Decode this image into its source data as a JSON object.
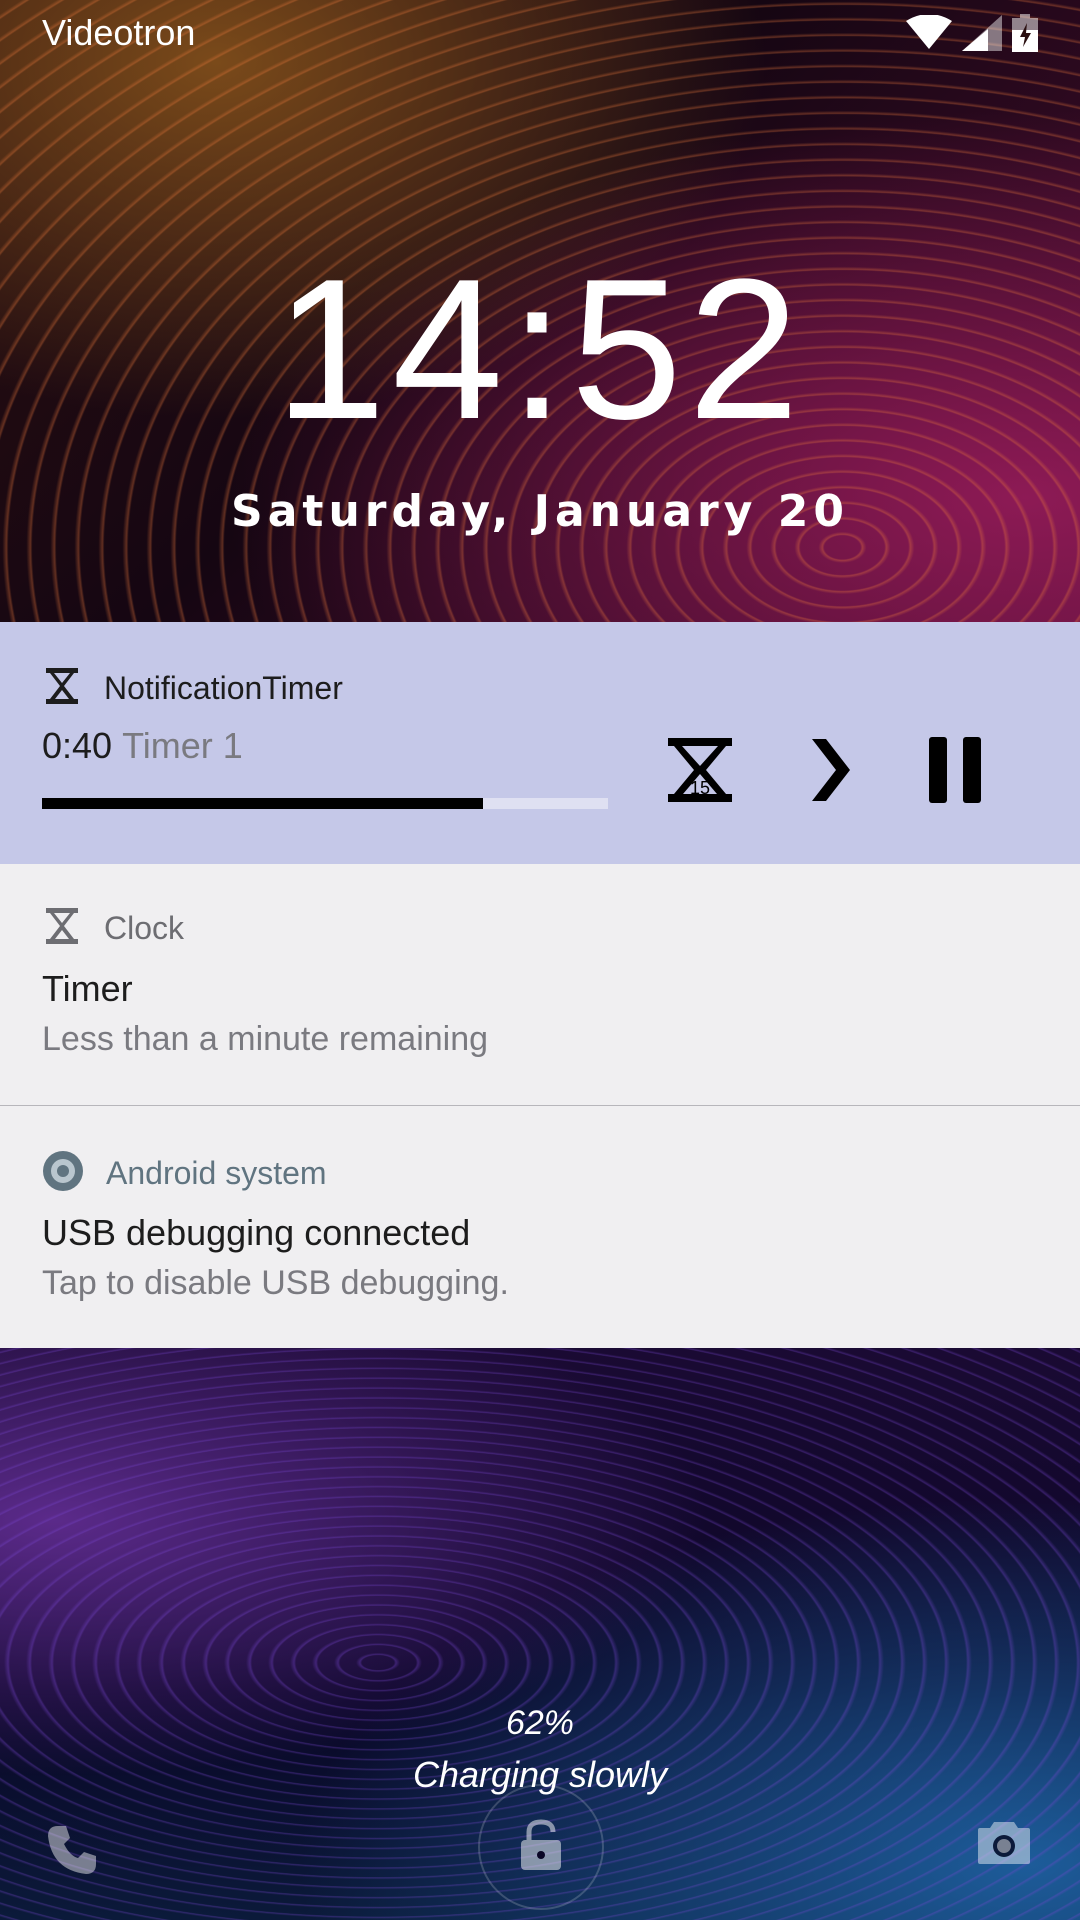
{
  "status_bar": {
    "carrier": "Videotron",
    "icons": [
      "wifi-icon",
      "cell-signal-icon",
      "battery-charging-icon"
    ]
  },
  "lockscreen": {
    "time": "14:52",
    "date": "Saturday, January 20"
  },
  "notifications": [
    {
      "app": "NotificationTimer",
      "time": "0:40",
      "label": "Timer 1",
      "progress_percent": 78,
      "actions": [
        "timer-15-icon",
        "chevron-right-icon",
        "pause-icon"
      ],
      "background": "#c5c8e8"
    },
    {
      "app": "Clock",
      "title": "Timer",
      "text": "Less than a minute remaining"
    },
    {
      "app": "Android system",
      "title": "USB debugging connected",
      "text": "Tap to disable USB debugging."
    }
  ],
  "footer": {
    "battery": "62%",
    "charging": "Charging slowly",
    "shortcuts": [
      "phone-icon",
      "lock-icon",
      "camera-icon"
    ]
  },
  "colors": {
    "timer_bg": "#c5c8e8",
    "notification_bg": "#f0eff1",
    "android_app_name": "#607480"
  }
}
